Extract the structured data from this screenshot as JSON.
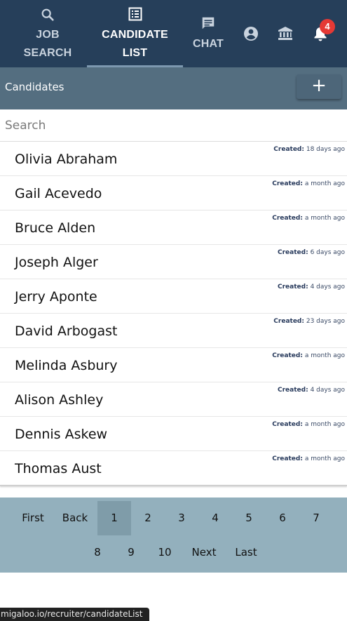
{
  "nav": {
    "job_search": {
      "line1": "JOB",
      "line2": "SEARCH",
      "icon": "search-icon"
    },
    "candidate_list": {
      "line1": "CANDIDATE",
      "line2": "LIST",
      "icon": "list-icon"
    },
    "chat": {
      "label": "CHAT",
      "icon": "chat-icon"
    },
    "account_icon": "account-icon",
    "bank_icon": "bank-icon",
    "bell_icon": "bell-icon",
    "notification_count": "4"
  },
  "header": {
    "title": "Candidates",
    "add_label": "+"
  },
  "search": {
    "placeholder": "Search",
    "value": ""
  },
  "candidates": [
    {
      "name": "Olivia Abraham",
      "created_label": "Created:",
      "created_value": "18 days ago"
    },
    {
      "name": "Gail Acevedo",
      "created_label": "Created:",
      "created_value": "a month ago"
    },
    {
      "name": "Bruce Alden",
      "created_label": "Created:",
      "created_value": "a month ago"
    },
    {
      "name": "Joseph Alger",
      "created_label": "Created:",
      "created_value": "6 days ago"
    },
    {
      "name": "Jerry Aponte",
      "created_label": "Created:",
      "created_value": "4 days ago"
    },
    {
      "name": "David Arbogast",
      "created_label": "Created:",
      "created_value": "23 days ago"
    },
    {
      "name": "Melinda Asbury",
      "created_label": "Created:",
      "created_value": "a month ago"
    },
    {
      "name": "Alison Ashley",
      "created_label": "Created:",
      "created_value": "4 days ago"
    },
    {
      "name": "Dennis Askew",
      "created_label": "Created:",
      "created_value": "a month ago"
    },
    {
      "name": "Thomas Aust",
      "created_label": "Created:",
      "created_value": "a month ago"
    }
  ],
  "pagination": {
    "first": "First",
    "back": "Back",
    "pages": [
      "1",
      "2",
      "3",
      "4",
      "5",
      "6",
      "7",
      "8",
      "9",
      "10"
    ],
    "current_page": "1",
    "next": "Next",
    "last": "Last"
  },
  "status_url": "migaloo.io/recruiter/candidateList",
  "colors": {
    "nav_bg": "#263f5a",
    "header_bg": "#546e80",
    "pager_bg": "#93b0bd",
    "badge": "#e53935"
  }
}
